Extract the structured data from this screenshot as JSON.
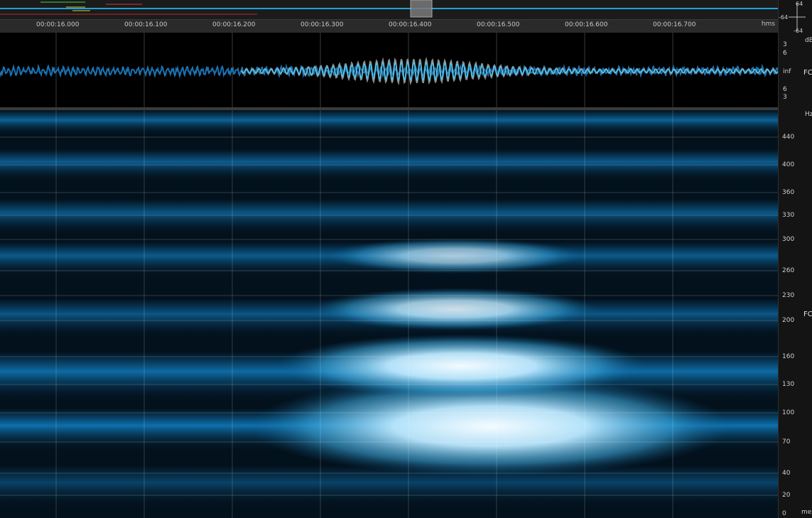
{
  "ruler": {
    "ticks": [
      "00:00:16.000",
      "00:00:16.100",
      "00:00:16.200",
      "00:00:16.300",
      "00:00:16.400",
      "00:00:16.500",
      "00:00:16.600",
      "00:00:16.700"
    ],
    "units": "hms"
  },
  "amp_scale": {
    "unit": "dB",
    "labels_top": [
      "3",
      "6"
    ],
    "center": "inf",
    "labels_bottom": [
      "6",
      "3"
    ],
    "corner_top": "64",
    "corner_top2": "-64",
    "corner_bottom": "-64"
  },
  "freq_scale": {
    "unit": "Hz",
    "labels": [
      "440",
      "400",
      "360",
      "330",
      "300",
      "260",
      "230",
      "200",
      "160",
      "130",
      "100",
      "70",
      "40",
      "20",
      "0"
    ],
    "footer": "mel"
  },
  "side_captions": {
    "waveform": "FC",
    "spectral": "FC"
  },
  "colors": {
    "accent": "#1ea2d6",
    "waveform": "#1a73b3",
    "playhead_selection": "#8a8a8a",
    "spectro_dark": "#03111c",
    "spectro_mid": "#0b5b8e",
    "spectro_bright": "#e8f6ff"
  }
}
